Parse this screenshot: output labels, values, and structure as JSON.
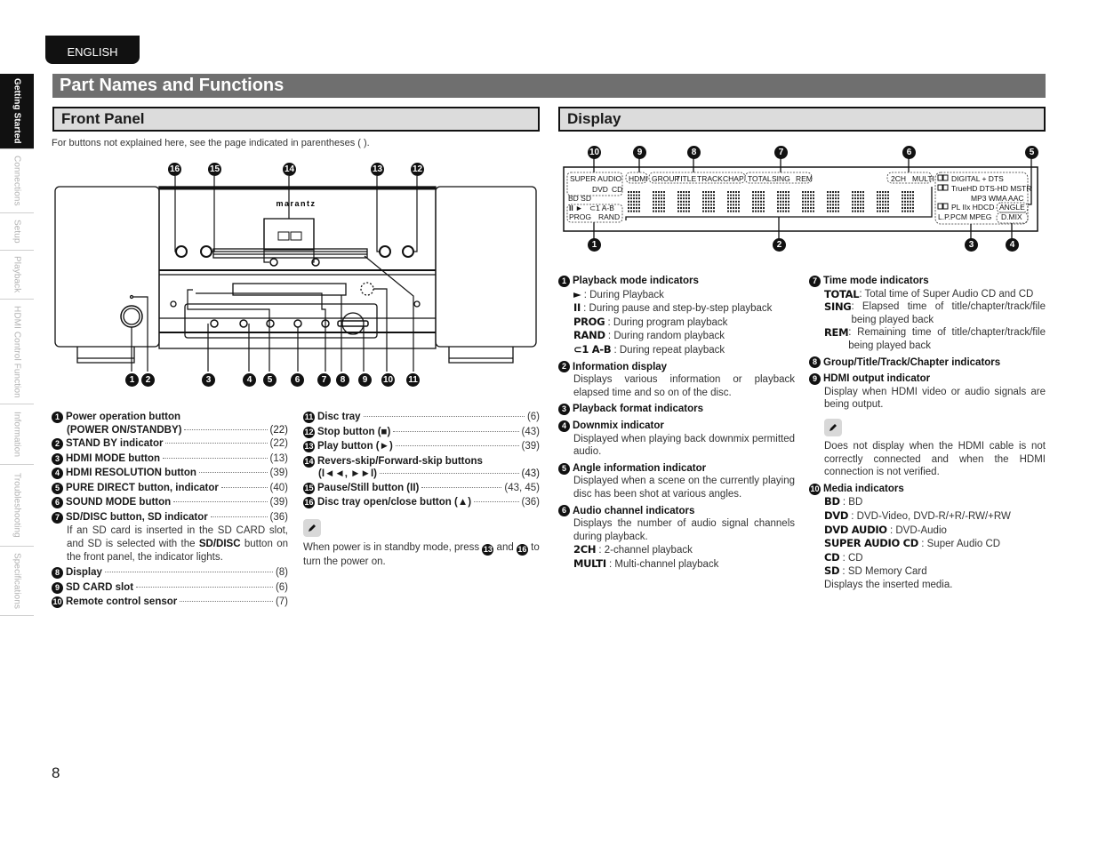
{
  "language_tab": "ENGLISH",
  "sidenav": [
    {
      "label": "Getting Started",
      "active": true
    },
    {
      "label": "Connections",
      "active": false
    },
    {
      "label": "Setup",
      "active": false
    },
    {
      "label": "Playback",
      "active": false
    },
    {
      "label": "HDMI Control Function",
      "active": false
    },
    {
      "label": "Information",
      "active": false
    },
    {
      "label": "Troubleshooting",
      "active": false
    },
    {
      "label": "Specifications",
      "active": false
    }
  ],
  "page_title": "Part Names and Functions",
  "front_panel": {
    "heading": "Front Panel",
    "note": "For buttons not explained here, see the page indicated in parentheses ( ).",
    "brand": "marantz",
    "parts_left": [
      {
        "n": "1",
        "label": "Power operation button",
        "label2": "(POWER ON/STANDBY)",
        "page": "(22)"
      },
      {
        "n": "2",
        "label": "STAND BY indicator",
        "page": "(22)"
      },
      {
        "n": "3",
        "label": "HDMI MODE button",
        "page": "(13)"
      },
      {
        "n": "4",
        "label": "HDMI RESOLUTION button",
        "page": "(39)"
      },
      {
        "n": "5",
        "label": "PURE DIRECT button, indicator",
        "page": "(40)"
      },
      {
        "n": "6",
        "label": "SOUND MODE button",
        "page": "(39)"
      },
      {
        "n": "7",
        "label": "SD/DISC button, SD indicator",
        "page": "(36)",
        "desc_a": "If an SD card is inserted in the SD CARD slot, and SD is selected with the ",
        "desc_bold": "SD/DISC",
        "desc_b": " button on the front panel, the indicator lights."
      },
      {
        "n": "8",
        "label": "Display",
        "page": "(8)"
      },
      {
        "n": "9",
        "label": "SD CARD slot",
        "page": "(6)"
      },
      {
        "n": "10",
        "label": "Remote control sensor",
        "page": "(7)"
      }
    ],
    "parts_right": [
      {
        "n": "11",
        "label": "Disc tray",
        "page": "(6)"
      },
      {
        "n": "12",
        "label": "Stop button (■)",
        "page": "(43)"
      },
      {
        "n": "13",
        "label": "Play button (►)",
        "page": "(39)"
      },
      {
        "n": "14",
        "label": "Revers-skip/Forward-skip buttons",
        "label2": "(I◄◄, ►►I)",
        "page": "(43)"
      },
      {
        "n": "15",
        "label": "Pause/Still button (II)",
        "page": "(43, 45)"
      },
      {
        "n": "16",
        "label": "Disc tray open/close button (▲)",
        "page": "(36)"
      }
    ],
    "memo": {
      "icon": "pencil-icon",
      "text_a": "When power is in standby mode, press ",
      "ref1": "13",
      "text_b": " and ",
      "ref2": "16",
      "text_c": " to turn the power on."
    }
  },
  "display": {
    "heading": "Display",
    "diagram": {
      "media": [
        "SUPER AUDIO",
        "DVD",
        "CD",
        "BD SD"
      ],
      "playback": [
        "II ►",
        "⊂1 A-B",
        "PROG",
        "RAND"
      ],
      "hdmi": "HDMI",
      "group": [
        "GROUP",
        "TITLE",
        "TRACK",
        "CHAP"
      ],
      "time": [
        "TOTAL",
        "SING",
        "REM"
      ],
      "channel": [
        "2CH",
        "MULTI"
      ],
      "formats": [
        "DIGITAL + DTS",
        "TrueHD DTS-HD MSTR",
        "MP3 WMA AAC",
        "PL IIx HDCD",
        "L.P.PCM MPEG"
      ],
      "angle": "ANGLE",
      "dmix": "D.MIX"
    },
    "items_left": [
      {
        "n": "1",
        "title": "Playback mode indicators",
        "lines": [
          {
            "k": "►",
            "v": " : During Playback"
          },
          {
            "k": "II",
            "v": " : During pause and step-by-step playback"
          },
          {
            "k": "PROG",
            "v": " : During program playback"
          },
          {
            "k": "RAND",
            "v": " : During random playback"
          },
          {
            "k": "⊂1 A-B",
            "v": " : During repeat playback"
          }
        ]
      },
      {
        "n": "2",
        "title": "Information display",
        "body": "Displays various information or playback elapsed time and so on of the disc."
      },
      {
        "n": "3",
        "title": "Playback format indicators"
      },
      {
        "n": "4",
        "title": "Downmix indicator",
        "body": "Displayed when playing back downmix permitted audio."
      },
      {
        "n": "5",
        "title": "Angle information indicator",
        "body": "Displayed when a scene on the currently playing disc has been shot at various angles."
      },
      {
        "n": "6",
        "title": "Audio channel indicators",
        "body": "Displays the number of audio signal channels during playback.",
        "lines": [
          {
            "k": "2CH",
            "v": " : 2-channel playback"
          },
          {
            "k": "MULTI",
            "v": " : Multi-channel playback"
          }
        ]
      }
    ],
    "items_right": [
      {
        "n": "7",
        "title": "Time mode indicators",
        "lines": [
          {
            "k": "TOTAL",
            "v": " : Total time of Super Audio CD and CD"
          },
          {
            "k": "SING",
            "v": " : Elapsed time of title/chapter/track/file being played back"
          },
          {
            "k": "REM",
            "v": " : Remaining time of title/chapter/track/file being played back"
          }
        ]
      },
      {
        "n": "8",
        "title": "Group/Title/Track/Chapter indicators"
      },
      {
        "n": "9",
        "title": "HDMI output indicator",
        "body": "Display when HDMI video or audio signals are being output.",
        "memo": "Does not display when the HDMI cable is not correctly connected and when the HDMI connection is not verified."
      },
      {
        "n": "10",
        "title": "Media indicators",
        "lines": [
          {
            "k": "BD",
            "v": " : BD"
          },
          {
            "k": "DVD",
            "v": " : DVD-Video, DVD-R/+R/-RW/+RW"
          },
          {
            "k": "DVD AUDIO",
            "v": " : DVD-Audio"
          },
          {
            "k": "SUPER AUDIO CD",
            "v": " : Super Audio CD"
          },
          {
            "k": "CD",
            "v": " : CD"
          },
          {
            "k": "SD",
            "v": " : SD Memory Card"
          }
        ],
        "footer": "Displays the inserted media."
      }
    ]
  },
  "page_number": "8"
}
